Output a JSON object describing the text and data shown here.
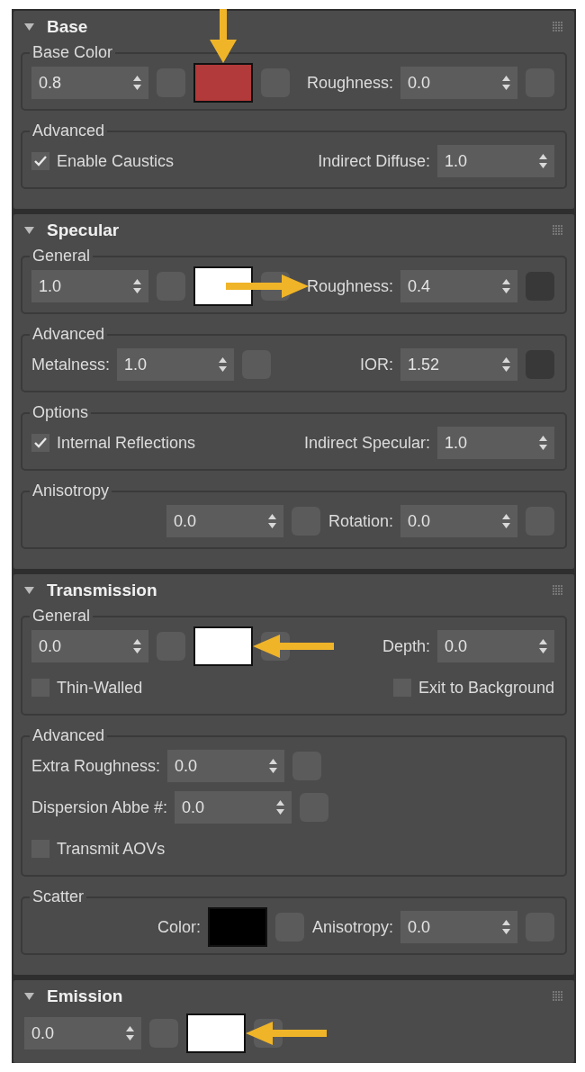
{
  "rollouts": [
    {
      "title": "Base",
      "expanded": true,
      "groups": [
        {
          "title": "Base Color",
          "rows": [
            {
              "left": [
                {
                  "kind": "spinner",
                  "value": "0.8"
                },
                {
                  "kind": "map",
                  "assigned": false
                },
                {
                  "kind": "swatch",
                  "color": "#b23a3a"
                },
                {
                  "kind": "arrow_down"
                },
                {
                  "kind": "map",
                  "assigned": false
                }
              ],
              "right": [
                {
                  "kind": "spinner",
                  "label": "Roughness:",
                  "value": "0.0"
                },
                {
                  "kind": "map",
                  "assigned": false
                }
              ]
            }
          ]
        },
        {
          "title": "Advanced",
          "rows": [
            {
              "left": [
                {
                  "kind": "checkbox",
                  "label": "Enable Caustics",
                  "checked": true
                }
              ],
              "right": [
                {
                  "kind": "spinner",
                  "label": "Indirect Diffuse:",
                  "value": "1.0"
                }
              ]
            }
          ]
        }
      ]
    },
    {
      "title": "Specular",
      "expanded": true,
      "groups": [
        {
          "title": "General",
          "rows": [
            {
              "left": [
                {
                  "kind": "spinner",
                  "value": "1.0"
                },
                {
                  "kind": "map",
                  "assigned": false
                },
                {
                  "kind": "swatch",
                  "color": "#ffffff"
                },
                {
                  "kind": "arrow_right"
                },
                {
                  "kind": "map",
                  "assigned": false
                }
              ],
              "right": [
                {
                  "kind": "spinner",
                  "label": "Roughness:",
                  "value": "0.4"
                },
                {
                  "kind": "map",
                  "assigned": true
                }
              ]
            }
          ]
        },
        {
          "title": "Advanced",
          "rows": [
            {
              "left": [
                {
                  "kind": "spinner",
                  "label": "Metalness:",
                  "value": "1.0"
                },
                {
                  "kind": "map",
                  "assigned": false
                }
              ],
              "right": [
                {
                  "kind": "spinner",
                  "label": "IOR:",
                  "value": "1.52"
                },
                {
                  "kind": "map",
                  "assigned": true
                }
              ]
            }
          ]
        },
        {
          "title": "Options",
          "rows": [
            {
              "left": [
                {
                  "kind": "checkbox",
                  "label": "Internal Reflections",
                  "checked": true
                }
              ],
              "right": [
                {
                  "kind": "spinner",
                  "label": "Indirect Specular:",
                  "value": "1.0"
                }
              ]
            }
          ]
        },
        {
          "title": "Anisotropy",
          "rows": [
            {
              "right": [
                {
                  "kind": "spinner",
                  "value": "0.0"
                },
                {
                  "kind": "map",
                  "assigned": false
                },
                {
                  "kind": "spinner",
                  "label": "Rotation:",
                  "value": "0.0"
                },
                {
                  "kind": "map",
                  "assigned": false
                }
              ]
            }
          ]
        }
      ]
    },
    {
      "title": "Transmission",
      "expanded": true,
      "groups": [
        {
          "title": "General",
          "rows": [
            {
              "left": [
                {
                  "kind": "spinner",
                  "value": "0.0"
                },
                {
                  "kind": "map",
                  "assigned": false
                },
                {
                  "kind": "swatch",
                  "color": "#ffffff"
                },
                {
                  "kind": "arrow_left"
                },
                {
                  "kind": "map",
                  "assigned": false
                }
              ],
              "right": [
                {
                  "kind": "spinner",
                  "label": "Depth:",
                  "value": "0.0"
                }
              ]
            },
            {
              "left": [
                {
                  "kind": "checkbox",
                  "label": "Thin-Walled",
                  "checked": false
                }
              ],
              "right": [
                {
                  "kind": "checkbox",
                  "label": "Exit to Background",
                  "checked": false
                }
              ]
            }
          ]
        },
        {
          "title": "Advanced",
          "rows": [
            {
              "left": [
                {
                  "kind": "spinner",
                  "label": "Extra Roughness:",
                  "value": "0.0"
                },
                {
                  "kind": "map",
                  "assigned": false
                }
              ]
            },
            {
              "left": [
                {
                  "kind": "spinner",
                  "label": "Dispersion Abbe #:",
                  "value": "0.0"
                },
                {
                  "kind": "map",
                  "assigned": false
                }
              ]
            },
            {
              "left": [
                {
                  "kind": "checkbox",
                  "label": "Transmit AOVs",
                  "checked": false
                }
              ]
            }
          ]
        },
        {
          "title": "Scatter",
          "rows": [
            {
              "right": [
                {
                  "kind": "swatch",
                  "label": "Color:",
                  "color": "#000000"
                },
                {
                  "kind": "map",
                  "assigned": false
                },
                {
                  "kind": "spinner",
                  "label": "Anisotropy:",
                  "value": "0.0"
                },
                {
                  "kind": "map",
                  "assigned": false
                }
              ]
            }
          ]
        }
      ]
    },
    {
      "title": "Emission",
      "expanded": true,
      "groups": [
        {
          "rows": [
            {
              "left": [
                {
                  "kind": "spinner",
                  "value": "0.0"
                },
                {
                  "kind": "map",
                  "assigned": false
                },
                {
                  "kind": "swatch",
                  "color": "#ffffff"
                },
                {
                  "kind": "arrow_left"
                },
                {
                  "kind": "map",
                  "assigned": false
                }
              ]
            }
          ]
        }
      ]
    }
  ]
}
